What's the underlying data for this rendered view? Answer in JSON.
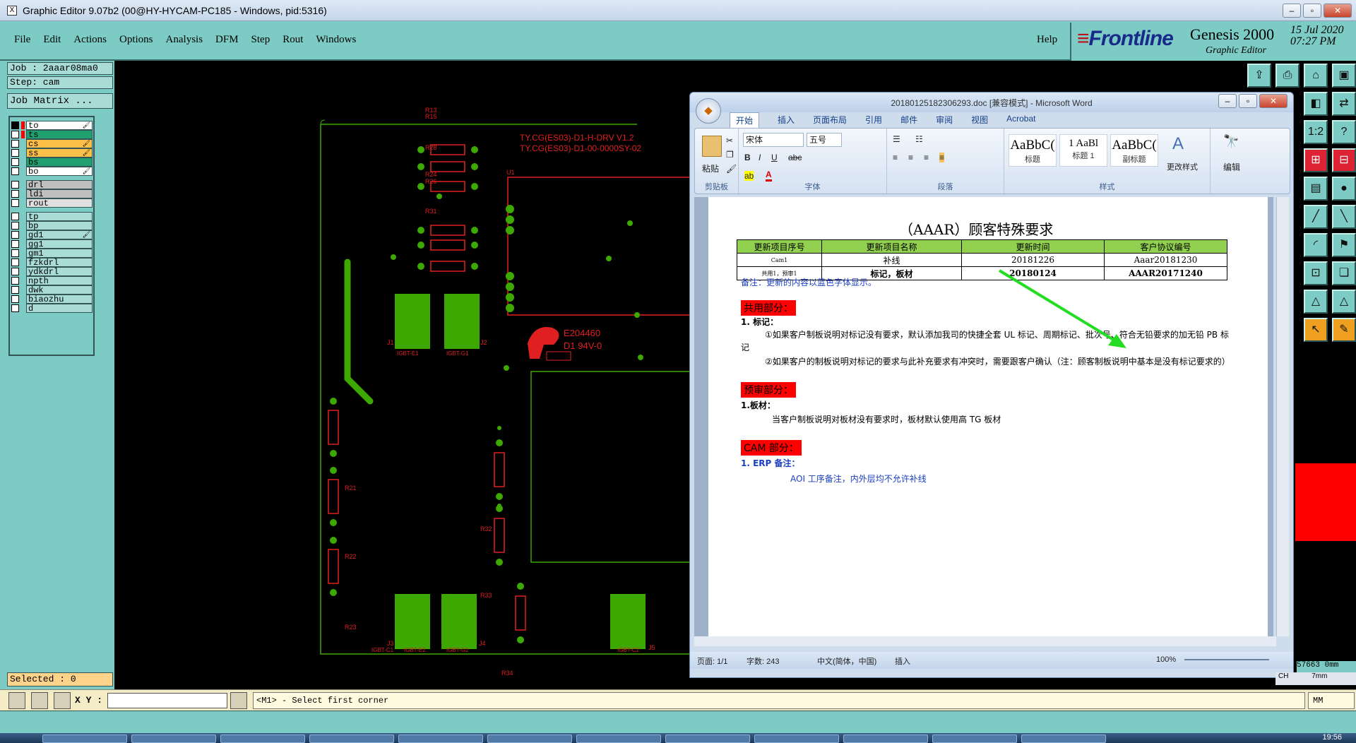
{
  "window": {
    "title": "Graphic Editor 9.07b2 (00@HY-HYCAM-PC185 - Windows, pid:5316)",
    "app_icon": "X"
  },
  "menu": {
    "items": [
      "File",
      "Edit",
      "Actions",
      "Options",
      "Analysis",
      "DFM",
      "Step",
      "Rout",
      "Windows"
    ],
    "help": "Help"
  },
  "logo": {
    "brand": "Frontline",
    "product": "Genesis 2000",
    "subtitle": "Graphic Editor",
    "date": "15 Jul 2020",
    "time": "07:27 PM"
  },
  "job": {
    "job_line": "Job : 2aaar08ma0",
    "step_line": "Step: cam",
    "matrix_button": "Job Matrix ..."
  },
  "layers": [
    {
      "name": "to",
      "color": "#ffffff",
      "swatch": "#ff0000",
      "flag": "🖌"
    },
    {
      "name": "ts",
      "color": "#20a070",
      "swatch": "#ff0000",
      "flag": ""
    },
    {
      "name": "cs",
      "color": "#ffc04a",
      "swatch": "",
      "flag": "🖌"
    },
    {
      "name": "ss",
      "color": "#ffc04a",
      "swatch": "",
      "flag": "🖌"
    },
    {
      "name": "bs",
      "color": "#20a070",
      "swatch": "",
      "flag": ""
    },
    {
      "name": "bo",
      "color": "#ffffff",
      "swatch": "",
      "flag": "🖌"
    },
    {
      "name": "drl",
      "color": "#c0c0c0",
      "swatch": "",
      "flag": ""
    },
    {
      "name": "ldi",
      "color": "#c0c0c0",
      "swatch": "",
      "flag": ""
    },
    {
      "name": "rout",
      "color": "#e0e0e0",
      "swatch": "",
      "flag": ""
    },
    {
      "name": "tp",
      "color": "#a9dcd7",
      "swatch": "",
      "flag": ""
    },
    {
      "name": "bp",
      "color": "#a9dcd7",
      "swatch": "",
      "flag": ""
    },
    {
      "name": "gd1",
      "color": "#a9dcd7",
      "swatch": "",
      "flag": "🖌"
    },
    {
      "name": "gg1",
      "color": "#a9dcd7",
      "swatch": "",
      "flag": ""
    },
    {
      "name": "gm1",
      "color": "#a9dcd7",
      "swatch": "",
      "flag": ""
    },
    {
      "name": "fzkdrl",
      "color": "#a9dcd7",
      "swatch": "",
      "flag": ""
    },
    {
      "name": "ydkdrl",
      "color": "#a9dcd7",
      "swatch": "",
      "flag": ""
    },
    {
      "name": "npth",
      "color": "#a9dcd7",
      "swatch": "",
      "flag": ""
    },
    {
      "name": "dwk",
      "color": "#a9dcd7",
      "swatch": "",
      "flag": ""
    },
    {
      "name": "biaozhu",
      "color": "#a9dcd7",
      "swatch": "",
      "flag": ""
    },
    {
      "name": "d",
      "color": "#a9dcd7",
      "swatch": "",
      "flag": ""
    }
  ],
  "selected": "Selected : 0",
  "command": {
    "xy_label": "X Y :",
    "xy_value": "",
    "message": "<M1> - Select first corner",
    "units": "MM"
  },
  "coords": {
    "x_readout": "57663 0mm",
    "y_readout": "7mm"
  },
  "pcb": {
    "silk1": "TY.CG(ES03)-D1-H-DRV V1.2",
    "silk2": "TY.CG(ES03)-D1-00-0000SY-02",
    "ul": "E204460",
    "rating": "D1  94V-0",
    "refs": [
      "R13",
      "R15",
      "R28",
      "R24",
      "R26",
      "R31",
      "R21",
      "R22",
      "R23",
      "R32",
      "R33",
      "R34",
      "U1",
      "J1",
      "J2",
      "J3",
      "J4",
      "J5"
    ],
    "igbt": [
      "IGBT-E1",
      "IGBT-G1",
      "IGBT-C1",
      "IGBT-E2",
      "IGBT-G2",
      "IGBT-C2"
    ]
  },
  "word": {
    "title": "20180125182306293.doc [兼容模式] - Microsoft Word",
    "tabs": [
      "开始",
      "插入",
      "页面布局",
      "引用",
      "邮件",
      "审阅",
      "视图",
      "Acrobat"
    ],
    "font_name": "宋体",
    "font_size": "五号",
    "groups": [
      "剪贴板",
      "字体",
      "段落",
      "样式",
      "编辑"
    ],
    "paste": "粘贴",
    "styles": [
      {
        "preview": "AaBbC(",
        "label": "标题"
      },
      {
        "preview": "1  AaBl",
        "label": "标题 1"
      },
      {
        "preview": "AaBbC(",
        "label": "副标题"
      }
    ],
    "change_styles": "更改样式",
    "edit": "编辑",
    "doc_title": "（AAAR）顾客特殊要求",
    "table_headers": [
      "更新项目序号",
      "更新项目名称",
      "更新时间",
      "客户协议编号"
    ],
    "table_rows": [
      [
        "Cam1",
        "补线",
        "20181226",
        "Aaar20181230"
      ],
      [
        "共用1，预审1",
        "标记，板材",
        "20180124",
        "AAAR20171240"
      ]
    ],
    "note": "备注：更新的内容以蓝色字体显示。",
    "sec1": "共用部分：",
    "sec1_item": "1. 标记：",
    "sec1_p1": "①如果客户制板说明对标记没有要求，默认添加我司的快捷全套 UL 标记、周期标记、批次号、符合无铅要求的加无铅 PB 标记",
    "sec1_p2": "②如果客户的制板说明对标记的要求与此补充要求有冲突时，需要跟客户确认（注：顾客制板说明中基本是没有标记要求的）",
    "sec2": "预审部分：",
    "sec2_item": "1.板材：",
    "sec2_p1": "当客户制板说明对板材没有要求时，板材默认使用高 TG 板材",
    "sec3": "CAM 部分：",
    "sec3_item": "1. ERP 备注：",
    "sec3_p1": "AOI 工序备注，内外层均不允许补线",
    "status_page": "页面: 1/1",
    "status_words": "字数: 243",
    "status_lang": "中文(简体，中国)",
    "status_mode": "插入",
    "zoom": "100%",
    "ime": "CH"
  },
  "taskbar_clock": "19:56",
  "colors": {
    "teal": "#7ccbc4",
    "pcb_green": "#3ca800",
    "pcb_red": "#e02020",
    "arrow": "#22dd22"
  }
}
